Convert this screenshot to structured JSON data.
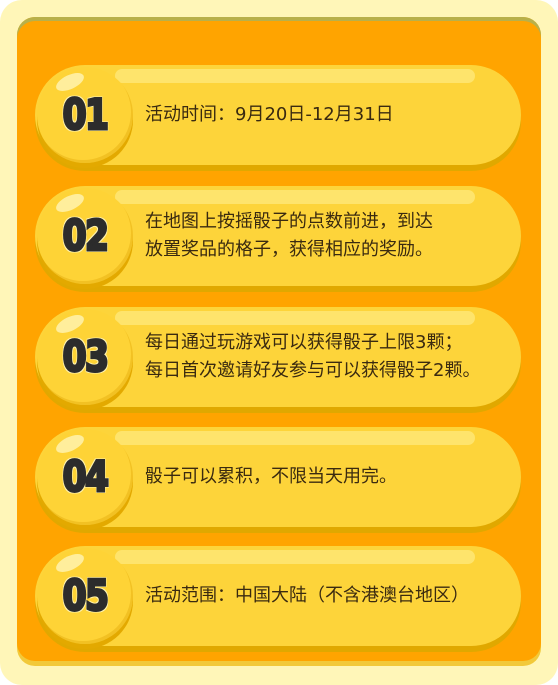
{
  "items": [
    {
      "number": "01",
      "lines": [
        "活动时间：9月20日-12月31日"
      ]
    },
    {
      "number": "02",
      "lines": [
        "在地图上按摇骰子的点数前进，到达",
        "放置奖品的格子，获得相应的奖励。"
      ]
    },
    {
      "number": "03",
      "lines": [
        "每日通过玩游戏可以获得骰子上限3颗；",
        "每日首次邀请好友参与可以获得骰子2颗。"
      ]
    },
    {
      "number": "04",
      "lines": [
        "骰子可以累积，不限当天用完。"
      ]
    },
    {
      "number": "05",
      "lines": [
        "活动范围：中国大陆（不含港澳台地区）"
      ]
    }
  ]
}
